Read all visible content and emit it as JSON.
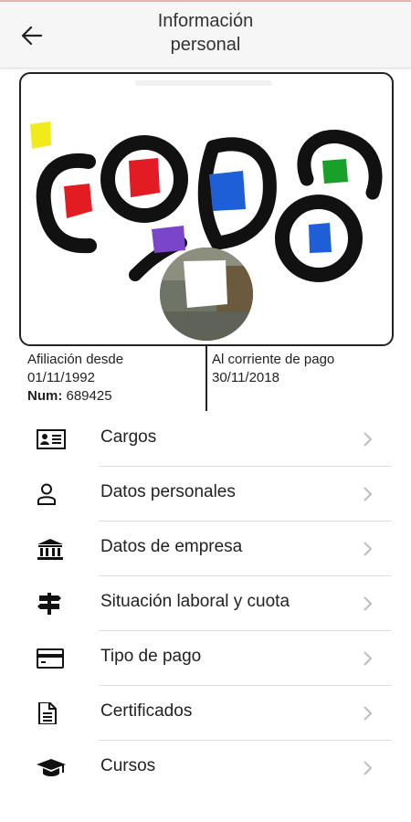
{
  "header": {
    "title": "Información personal"
  },
  "membership": {
    "since_label": "Afiliación desde",
    "since_date": "01/11/1992",
    "num_label": "Num:",
    "num_value": "689425",
    "payment_label": "Al corriente de pago",
    "payment_date": "30/11/2018"
  },
  "menu": [
    {
      "label": "Cargos",
      "icon": "id-card-icon"
    },
    {
      "label": "Datos personales",
      "icon": "person-icon"
    },
    {
      "label": "Datos de empresa",
      "icon": "bank-icon"
    },
    {
      "label": "Situación laboral y cuota",
      "icon": "signpost-icon"
    },
    {
      "label": "Tipo de pago",
      "icon": "credit-card-icon"
    },
    {
      "label": "Certificados",
      "icon": "document-icon"
    },
    {
      "label": "Cursos",
      "icon": "graduation-cap-icon"
    }
  ],
  "colors": {
    "logo_red": "#e31b23",
    "logo_blue": "#1e5fd8",
    "logo_green": "#17a02a",
    "logo_yellow": "#f2ea1a",
    "logo_purple": "#7a45c9"
  }
}
